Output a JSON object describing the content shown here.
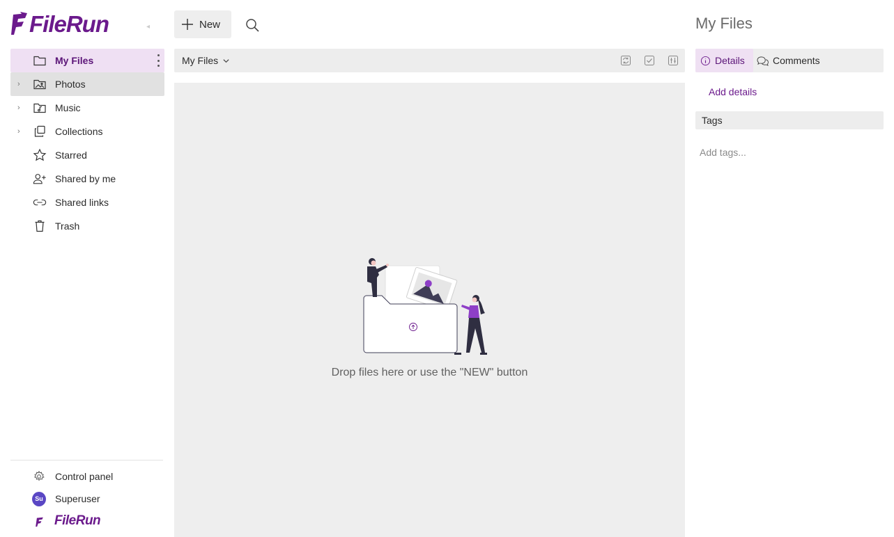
{
  "app": {
    "brand": "FileRun",
    "accent": "#6b1a8c"
  },
  "sidebar": {
    "items": [
      {
        "label": "My Files",
        "icon": "folder-icon",
        "active": true
      },
      {
        "label": "Photos",
        "icon": "photos-folder-icon",
        "expandable": true
      },
      {
        "label": "Music",
        "icon": "music-folder-icon",
        "expandable": true
      },
      {
        "label": "Collections",
        "icon": "collections-icon",
        "expandable": true
      },
      {
        "label": "Starred",
        "icon": "star-icon"
      },
      {
        "label": "Shared by me",
        "icon": "user-plus-icon"
      },
      {
        "label": "Shared links",
        "icon": "link-icon"
      },
      {
        "label": "Trash",
        "icon": "trash-icon"
      }
    ],
    "bottom": {
      "control_panel": "Control panel",
      "user_name": "Superuser",
      "user_initials": "Su",
      "footer_brand": "FileRun"
    }
  },
  "toolbar": {
    "new_label": "New"
  },
  "breadcrumb": {
    "current": "My Files"
  },
  "drop_area": {
    "message": "Drop files here or use the \"NEW\" button"
  },
  "right_panel": {
    "title": "My Files",
    "tabs": [
      {
        "label": "Details",
        "active": true
      },
      {
        "label": "Comments"
      }
    ],
    "add_details": "Add details",
    "tags_header": "Tags",
    "tags_placeholder": "Add tags..."
  }
}
